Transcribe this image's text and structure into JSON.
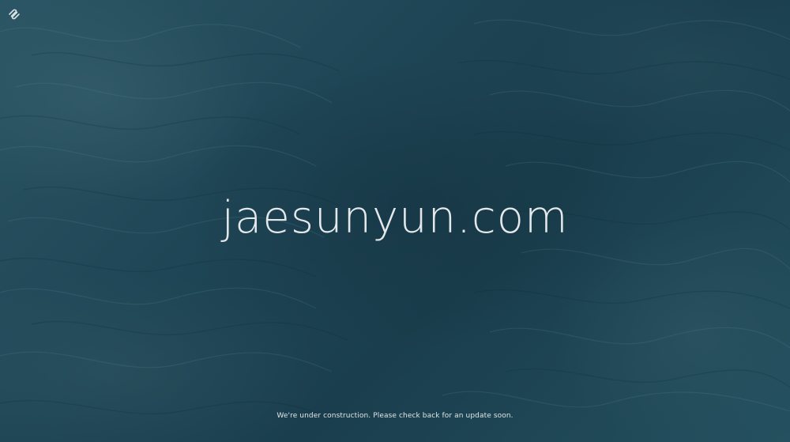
{
  "brand": {
    "logo_icon": "squarespace-logo-icon"
  },
  "main": {
    "title": "jaesunyun.com",
    "message": "We're under construction. Please check back for an update soon."
  },
  "colors": {
    "background": "#1e4453",
    "text": "#e4e8ea"
  }
}
